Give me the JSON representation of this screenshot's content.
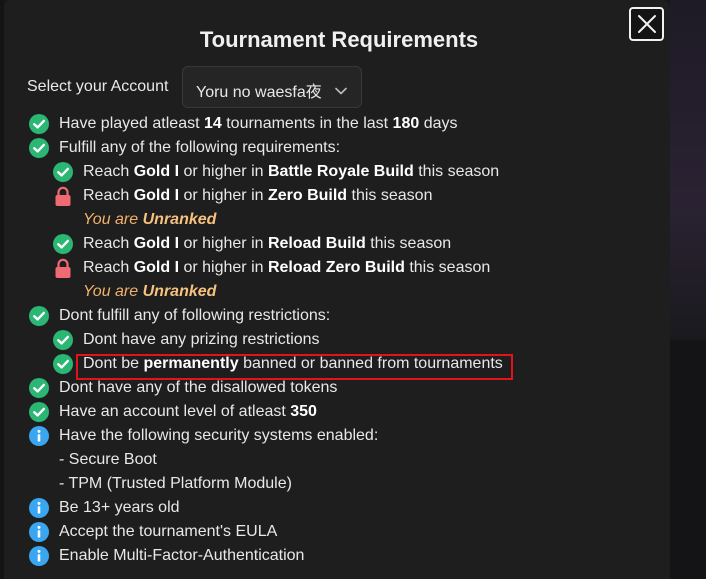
{
  "title": "Tournament Requirements",
  "account": {
    "label": "Select your Account",
    "selected": "Yoru no waesfa夜"
  },
  "requirements": [
    {
      "status": "check",
      "parts": [
        {
          "t": "Have played atleast "
        },
        {
          "t": "14",
          "b": true
        },
        {
          "t": " tournaments in the last "
        },
        {
          "t": "180",
          "b": true
        },
        {
          "t": " days"
        }
      ]
    },
    {
      "status": "check",
      "parts": [
        {
          "t": "Fulfill any of the following requirements:"
        }
      ]
    },
    {
      "status": "check",
      "parts": [
        {
          "t": "Reach "
        },
        {
          "t": "Gold I",
          "b": true
        },
        {
          "t": " or higher in "
        },
        {
          "t": "Battle Royale Build",
          "b": true
        },
        {
          "t": " this season"
        }
      ]
    },
    {
      "status": "lock",
      "parts": [
        {
          "t": "Reach "
        },
        {
          "t": "Gold I",
          "b": true
        },
        {
          "t": " or higher in "
        },
        {
          "t": "Zero Build",
          "b": true
        },
        {
          "t": " this season"
        }
      ]
    },
    {
      "status": "note",
      "parts": [
        {
          "t": "You are "
        },
        {
          "t": "Unranked",
          "b": true
        }
      ]
    },
    {
      "status": "check",
      "parts": [
        {
          "t": "Reach "
        },
        {
          "t": "Gold I",
          "b": true
        },
        {
          "t": " or higher in "
        },
        {
          "t": "Reload Build",
          "b": true
        },
        {
          "t": " this season"
        }
      ]
    },
    {
      "status": "lock",
      "parts": [
        {
          "t": "Reach "
        },
        {
          "t": "Gold I",
          "b": true
        },
        {
          "t": " or higher in "
        },
        {
          "t": "Reload Zero Build",
          "b": true
        },
        {
          "t": " this season"
        }
      ]
    },
    {
      "status": "note",
      "parts": [
        {
          "t": "You are "
        },
        {
          "t": "Unranked",
          "b": true
        }
      ]
    },
    {
      "status": "check",
      "parts": [
        {
          "t": "Dont fulfill any of following restrictions:"
        }
      ]
    },
    {
      "status": "check",
      "parts": [
        {
          "t": "Dont have any prizing restrictions"
        }
      ]
    },
    {
      "status": "check",
      "parts": [
        {
          "t": "Dont be "
        },
        {
          "t": "permanently",
          "b": true
        },
        {
          "t": " banned or banned from tournaments"
        }
      ]
    },
    {
      "status": "check",
      "parts": [
        {
          "t": "Dont have any of the disallowed tokens"
        }
      ]
    },
    {
      "status": "check",
      "parts": [
        {
          "t": "Have an account level of atleast "
        },
        {
          "t": "350",
          "b": true
        }
      ]
    },
    {
      "status": "info",
      "parts": [
        {
          "t": "Have the following security systems enabled:"
        }
      ]
    },
    {
      "status": "plain",
      "parts": [
        {
          "t": "- Secure Boot"
        }
      ]
    },
    {
      "status": "plain",
      "parts": [
        {
          "t": "- TPM (Trusted Platform Module)"
        }
      ]
    },
    {
      "status": "info",
      "parts": [
        {
          "t": "Be 13+ years old"
        }
      ]
    },
    {
      "status": "info",
      "parts": [
        {
          "t": "Accept the tournament's EULA"
        }
      ]
    },
    {
      "status": "info",
      "parts": [
        {
          "t": "Enable Multi-Factor-Authentication"
        }
      ]
    }
  ],
  "colors": {
    "check": "#2bb673",
    "lock": "#f06a72",
    "info": "#3aa6f0",
    "note": "#f1b26a",
    "highlight": "#e2141b"
  },
  "icons": {
    "close": "close-icon",
    "check": "check-circle-icon",
    "lock": "lock-icon",
    "info": "info-circle-icon",
    "chevron": "chevron-down-icon"
  }
}
